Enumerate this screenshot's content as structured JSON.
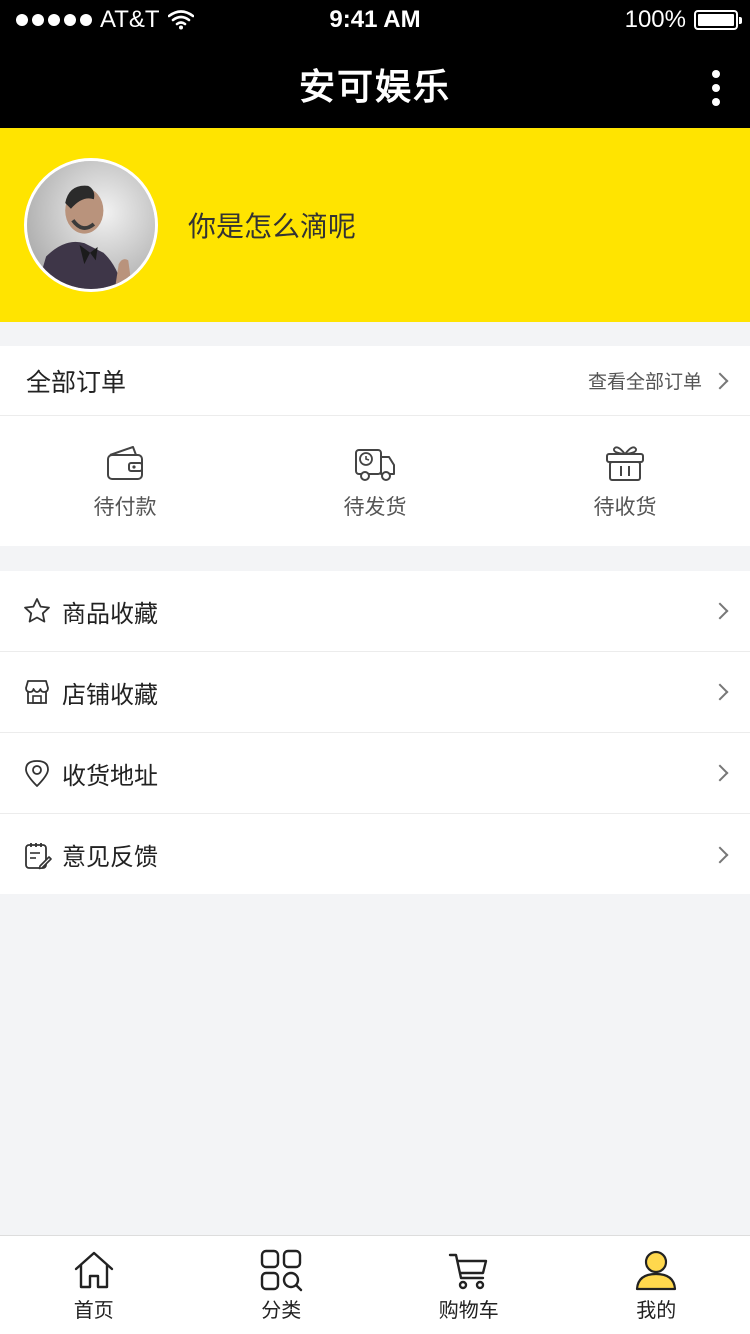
{
  "status_bar": {
    "carrier": "AT&T",
    "time": "9:41 AM",
    "battery": "100%"
  },
  "nav": {
    "title": "安可娱乐"
  },
  "profile": {
    "username": "你是怎么滴呢"
  },
  "orders": {
    "title": "全部订单",
    "view_all": "查看全部订单",
    "items": [
      {
        "label": "待付款",
        "icon": "wallet-icon"
      },
      {
        "label": "待发货",
        "icon": "truck-icon"
      },
      {
        "label": "待收货",
        "icon": "gift-icon"
      }
    ]
  },
  "menu": {
    "items": [
      {
        "label": "商品收藏",
        "icon": "star-icon"
      },
      {
        "label": "店铺收藏",
        "icon": "store-icon"
      },
      {
        "label": "收货地址",
        "icon": "location-pin-icon"
      },
      {
        "label": "意见反馈",
        "icon": "feedback-icon"
      }
    ]
  },
  "tabbar": {
    "items": [
      {
        "label": "首页",
        "icon": "home-icon"
      },
      {
        "label": "分类",
        "icon": "category-icon"
      },
      {
        "label": "购物车",
        "icon": "cart-icon"
      },
      {
        "label": "我的",
        "icon": "user-icon",
        "active": true
      }
    ]
  },
  "colors": {
    "brand_yellow": "#ffe400",
    "header_black": "#000000",
    "background": "#f3f4f6",
    "active_tab": "#ffd84d"
  }
}
